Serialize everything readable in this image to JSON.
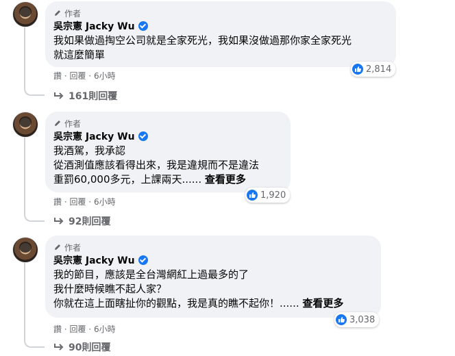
{
  "comments": [
    {
      "author_badge": "作者",
      "name": "吳宗憲 Jacky Wu",
      "text_lines": [
        "我如果做過掏空公司就是全家死光，我如果沒做過那你家全家死光",
        "就這麼簡單"
      ],
      "see_more": "",
      "reaction_count": "2,814",
      "actions": {
        "like": "讚",
        "reply": "回覆",
        "time": "6小時"
      },
      "replies_label": "161則回覆"
    },
    {
      "author_badge": "作者",
      "name": "吳宗憲 Jacky Wu",
      "text_lines": [
        "我酒駕，我承認",
        "從酒測值應該看得出來，我是違規而不是違法",
        "重罰60,000多元，上課兩天......"
      ],
      "see_more": "查看更多",
      "reaction_count": "1,920",
      "actions": {
        "like": "讚",
        "reply": "回覆",
        "time": "6小時"
      },
      "replies_label": "92則回覆"
    },
    {
      "author_badge": "作者",
      "name": "吳宗憲 Jacky Wu",
      "text_lines": [
        "我的節目，應該是全台灣網紅上過最多的了",
        "我什麼時候瞧不起人家？",
        "你就在這上面瞎扯你的觀點，我是真的瞧不起你！......"
      ],
      "see_more": "查看更多",
      "reaction_count": "3,038",
      "actions": {
        "like": "讚",
        "reply": "回覆",
        "time": "6小時"
      },
      "replies_label": "90則回覆"
    }
  ],
  "colors": {
    "bubble": "#f0f2f5",
    "accent": "#1877f2",
    "secondary_text": "#65676b"
  }
}
